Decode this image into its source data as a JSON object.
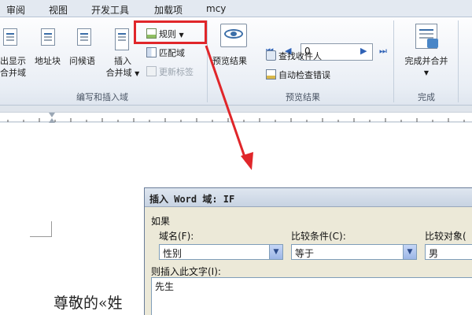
{
  "tabs": [
    {
      "label": "审阅"
    },
    {
      "label": "视图"
    },
    {
      "label": "开发工具"
    },
    {
      "label": "加载项"
    },
    {
      "label": "mcy"
    }
  ],
  "ribbon": {
    "group1": {
      "btn1_line1": "出显示",
      "btn1_line2": "合并域",
      "btn2": "地址块",
      "btn3": "问候语",
      "btn4_line1": "插入",
      "btn4_line2": "合并域",
      "rules": "规则",
      "match": "匹配域",
      "update": "更新标签",
      "label": "编写和插入域"
    },
    "group2": {
      "preview_results": "预览结果",
      "record_value": "0",
      "find_recipient": "查找收件人",
      "auto_check": "自动检查错误",
      "label": "预览结果"
    },
    "group3": {
      "finish": "完成并合并",
      "label": "完成"
    }
  },
  "document": {
    "greeting": "尊敬的«姓"
  },
  "dialog": {
    "title": "插入 Word 域: IF",
    "section": "如果",
    "field_name_label": "域名(F):",
    "field_name_value": "性别",
    "comparison_label": "比较条件(C):",
    "comparison_value": "等于",
    "compare_to_label": "比较对象(",
    "compare_to_value": "男",
    "insert_text_label": "则插入此文字(I):",
    "insert_text_value": "先生"
  },
  "colors": {
    "highlight": "#e0262a",
    "arrow": "#e0262a",
    "ribbon_bg": "#eef2f7"
  }
}
